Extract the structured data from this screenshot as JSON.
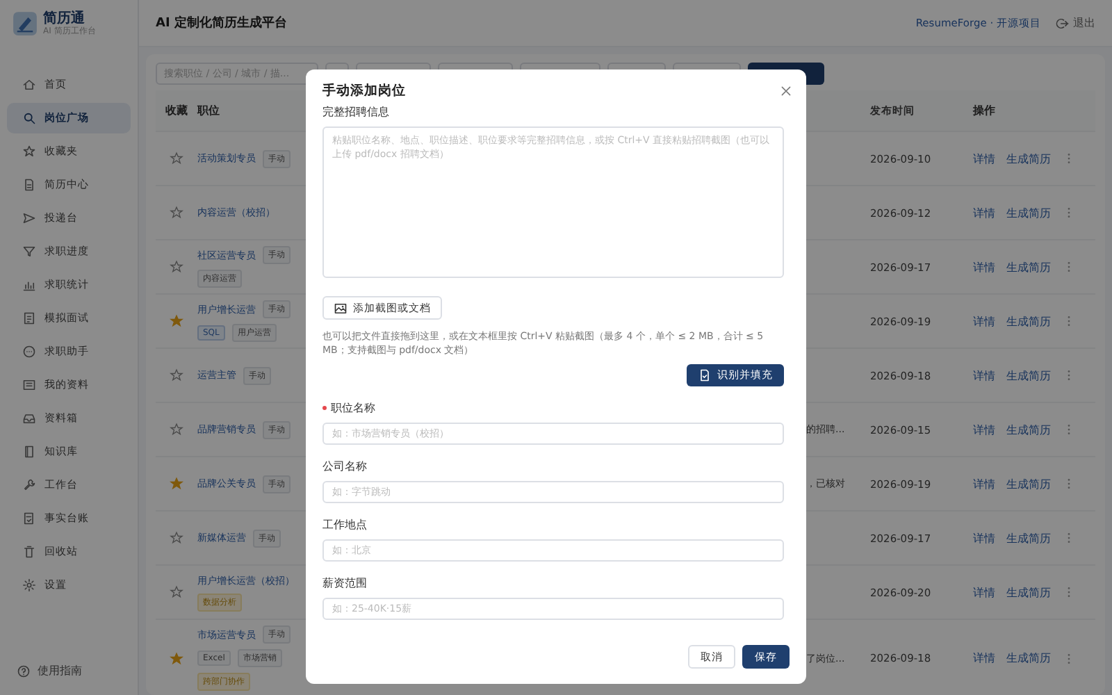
{
  "app": {
    "name": "简历通",
    "subtitle": "AI 简历工作台"
  },
  "sidebar": {
    "items": [
      {
        "label": "首页",
        "selected": false
      },
      {
        "label": "岗位广场",
        "selected": true
      },
      {
        "label": "收藏夹",
        "selected": false
      },
      {
        "label": "简历中心",
        "selected": false
      },
      {
        "label": "投递台",
        "selected": false
      },
      {
        "label": "求职进度",
        "selected": false
      },
      {
        "label": "求职统计",
        "selected": false
      },
      {
        "label": "模拟面试",
        "selected": false
      },
      {
        "label": "求职助手",
        "selected": false
      },
      {
        "label": "我的资料",
        "selected": false
      },
      {
        "label": "资料箱",
        "selected": false
      },
      {
        "label": "知识库",
        "selected": false
      },
      {
        "label": "工作台",
        "selected": false
      },
      {
        "label": "事实台账",
        "selected": false
      },
      {
        "label": "回收站",
        "selected": false
      },
      {
        "label": "设置",
        "selected": false
      }
    ],
    "footer": "使用指南"
  },
  "header": {
    "title": "AI 定制化简历生成平台",
    "link": "ResumeForge · 开源项目",
    "logout": "退出"
  },
  "toolbar": {
    "search_placeholder": "搜索职位 / 公司 / 城市 / 描..."
  },
  "table": {
    "columns": [
      "收藏",
      "职位",
      "发布时间",
      "操作"
    ],
    "rows": [
      {
        "starred": false,
        "title": "活动策划专员",
        "tags": [
          {
            "label": "手动",
            "kind": "plain"
          }
        ],
        "date": "2026-09-10",
        "actions": [
          "详情",
          "生成简历"
        ]
      },
      {
        "starred": false,
        "title": "内容运营（校招）",
        "date": "2026-09-12",
        "actions": [
          "详情",
          "生成简历"
        ]
      },
      {
        "starred": false,
        "title": "社区运营专员",
        "tags": [
          {
            "label": "手动",
            "kind": "plain"
          }
        ],
        "skill_lines": [
          [
            {
              "label": "内容运营",
              "kind": "plain"
            }
          ]
        ],
        "date": "2026-09-17",
        "actions": [
          "详情",
          "生成简历"
        ]
      },
      {
        "starred": true,
        "title": "用户增长运营",
        "tags": [
          {
            "label": "手动",
            "kind": "plain"
          }
        ],
        "skill_lines": [
          [
            {
              "label": "SQL",
              "kind": "blue"
            },
            {
              "label": "用户运营",
              "kind": "plain"
            }
          ]
        ],
        "date": "2026-09-19",
        "actions": [
          "详情",
          "生成简历"
        ]
      },
      {
        "starred": false,
        "title": "运营主管",
        "tags": [
          {
            "label": "手动",
            "kind": "plain"
          }
        ],
        "date": "2026-09-18",
        "actions": [
          "详情",
          "生成简历"
        ]
      },
      {
        "starred": false,
        "title": "品牌营销专员",
        "tags": [
          {
            "label": "手动",
            "kind": "plain"
          }
        ],
        "description": "的招聘...",
        "date": "2026-09-15",
        "actions": [
          "详情",
          "生成简历"
        ]
      },
      {
        "starred": true,
        "title": "品牌公关专员",
        "tags": [
          {
            "label": "手动",
            "kind": "plain"
          }
        ],
        "description": "，已核对",
        "date": "2026-09-19",
        "actions": [
          "详情",
          "生成简历"
        ]
      },
      {
        "starred": false,
        "title": "新媒体运营",
        "tags": [
          {
            "label": "手动",
            "kind": "plain"
          }
        ],
        "date": "2026-09-17",
        "actions": [
          "详情",
          "生成简历"
        ]
      },
      {
        "starred": false,
        "title": "用户增长运营（校招）",
        "skill_lines": [
          [
            {
              "label": "数据分析",
              "kind": "yellow"
            }
          ]
        ],
        "date": "2026-09-20",
        "actions": [
          "详情",
          "生成简历"
        ]
      },
      {
        "starred": true,
        "title": "市场运营专员",
        "tags": [
          {
            "label": "手动",
            "kind": "plain"
          }
        ],
        "skill_lines": [
          [
            {
              "label": "Excel",
              "kind": "plain"
            },
            {
              "label": "市场营销",
              "kind": "plain"
            }
          ],
          [
            {
              "label": "跨部门协作",
              "kind": "yellow"
            }
          ]
        ],
        "description": "了岗位...",
        "date": "2026-09-18",
        "actions": [
          "详情",
          "生成简历"
        ]
      }
    ]
  },
  "dialog": {
    "title": "手动添加岗位",
    "description_label": "完整招聘信息",
    "description_placeholder": "粘贴职位名称、地点、职位描述、职位要求等完整招聘信息，或按 Ctrl+V 直接粘贴招聘截图（也可以上传 pdf/docx 招聘文档）",
    "attach_button": "添加截图或文档",
    "hint": "也可以把文件直接拖到这里，或在文本框里按 Ctrl+V 粘贴截图（最多 4 个，单个 ≤ 2 MB，合计 ≤ 5 MB；支持截图与 pdf/docx 文档）",
    "recognize_button": "识别并填充",
    "fields": [
      {
        "label": "职位名称",
        "required": true,
        "placeholder": "如：市场营销专员（校招）"
      },
      {
        "label": "公司名称",
        "required": false,
        "placeholder": "如：字节跳动"
      },
      {
        "label": "工作地点",
        "required": false,
        "placeholder": "如：北京"
      },
      {
        "label": "薪资范围",
        "required": false,
        "placeholder": "如：25-40K·15薪"
      }
    ],
    "buttons": [
      {
        "label": "取消",
        "kind": "secondary"
      },
      {
        "label": "保存",
        "kind": "primary"
      }
    ]
  }
}
